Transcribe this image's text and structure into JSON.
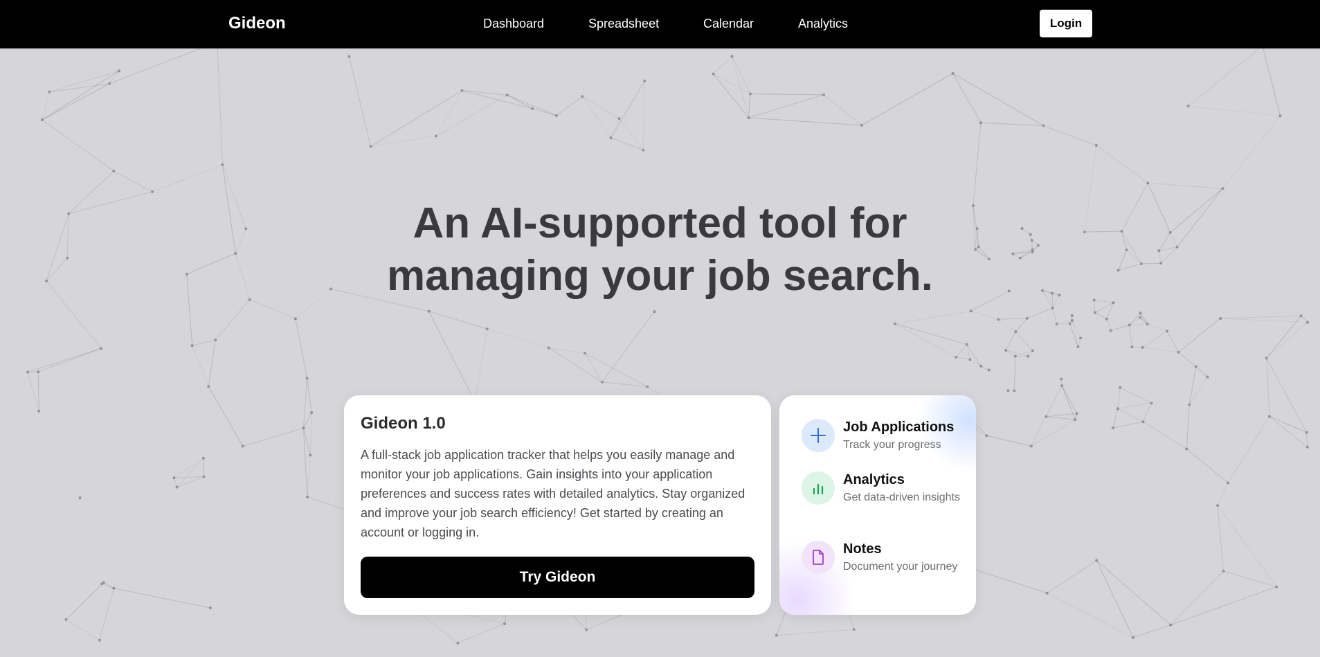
{
  "nav": {
    "brand": "Gideon",
    "links": [
      {
        "label": "Dashboard"
      },
      {
        "label": "Spreadsheet"
      },
      {
        "label": "Calendar"
      },
      {
        "label": "Analytics"
      }
    ],
    "login_label": "Login"
  },
  "hero": {
    "title_line1": "An AI-supported tool for",
    "title_line2": "managing your job search."
  },
  "card": {
    "title": "Gideon 1.0",
    "description": "A full-stack job application tracker that helps you easily manage and monitor your job applications. Gain insights into your application preferences and success rates with detailed analytics. Stay organized and improve your job search efficiency! Get started by creating an account or logging in.",
    "cta_label": "Try Gideon"
  },
  "features": [
    {
      "title": "Job Applications",
      "subtitle": "Track your progress",
      "icon": "plus-icon",
      "color": "#2f6fd6",
      "bg": "#dce8fb"
    },
    {
      "title": "Analytics",
      "subtitle": "Get data-driven insights",
      "icon": "bar-chart-icon",
      "color": "#1e9e5a",
      "bg": "#dcf5e6"
    },
    {
      "title": "Notes",
      "subtitle": "Document your journey",
      "icon": "document-icon",
      "color": "#a33bd4",
      "bg": "#f1e4fa"
    }
  ]
}
